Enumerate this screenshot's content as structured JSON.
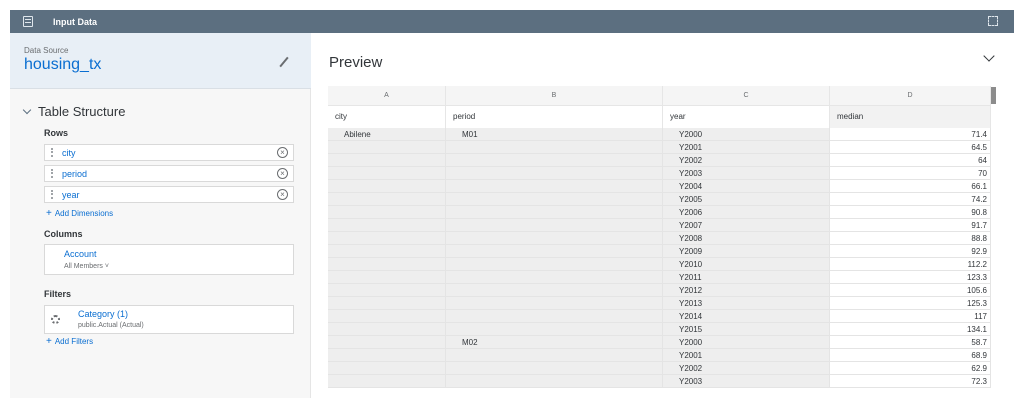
{
  "topbar": {
    "title": "Input Data",
    "app_icon": "table-icon",
    "restore_icon": "restore-icon"
  },
  "datasource": {
    "label": "Data Source",
    "name": "housing_tx",
    "edit_icon": "pencil-icon"
  },
  "table_structure": {
    "title": "Table Structure",
    "rows_label": "Rows",
    "rows": [
      "city",
      "period",
      "year"
    ],
    "add_dimensions": "Add Dimensions",
    "columns_label": "Columns",
    "account": {
      "name": "Account",
      "members": "All Members"
    },
    "filters_label": "Filters",
    "filter": {
      "name": "Category (1)",
      "detail": "public.Actual (Actual)"
    },
    "add_filters": "Add Filters"
  },
  "preview": {
    "title": "Preview",
    "col_letters": [
      "A",
      "B",
      "C",
      "D"
    ],
    "fields": [
      "city",
      "period",
      "year",
      "median"
    ],
    "rows": [
      [
        "Abilene",
        "M01",
        "Y2000",
        "71.4"
      ],
      [
        "",
        "",
        "Y2001",
        "64.5"
      ],
      [
        "",
        "",
        "Y2002",
        "64"
      ],
      [
        "",
        "",
        "Y2003",
        "70"
      ],
      [
        "",
        "",
        "Y2004",
        "66.1"
      ],
      [
        "",
        "",
        "Y2005",
        "74.2"
      ],
      [
        "",
        "",
        "Y2006",
        "90.8"
      ],
      [
        "",
        "",
        "Y2007",
        "91.7"
      ],
      [
        "",
        "",
        "Y2008",
        "88.8"
      ],
      [
        "",
        "",
        "Y2009",
        "92.9"
      ],
      [
        "",
        "",
        "Y2010",
        "112.2"
      ],
      [
        "",
        "",
        "Y2011",
        "123.3"
      ],
      [
        "",
        "",
        "Y2012",
        "105.6"
      ],
      [
        "",
        "",
        "Y2013",
        "125.3"
      ],
      [
        "",
        "",
        "Y2014",
        "117"
      ],
      [
        "",
        "",
        "Y2015",
        "134.1"
      ],
      [
        "",
        "M02",
        "Y2000",
        "58.7"
      ],
      [
        "",
        "",
        "Y2001",
        "68.9"
      ],
      [
        "",
        "",
        "Y2002",
        "62.9"
      ],
      [
        "",
        "",
        "Y2003",
        "72.3"
      ]
    ]
  }
}
